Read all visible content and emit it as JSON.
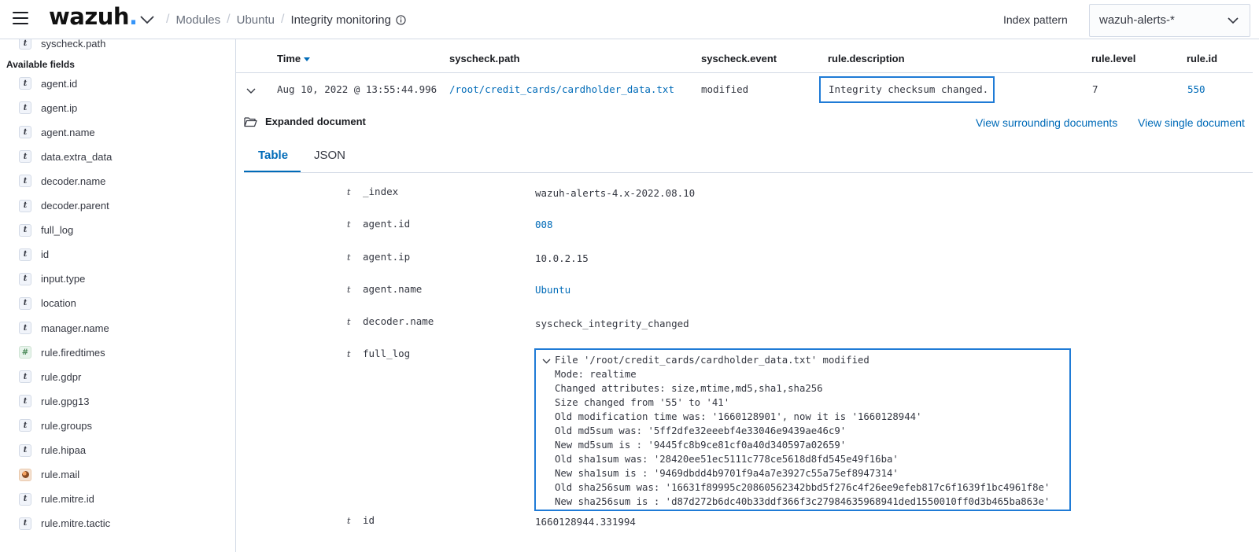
{
  "header": {
    "logo_text": "wazuh",
    "logo_dot": ".",
    "breadcrumbs": [
      "Modules",
      "Ubuntu"
    ],
    "current_page": "Integrity monitoring",
    "index_pattern_label": "Index pattern",
    "index_pattern_value": "wazuh-alerts-*"
  },
  "sidebar": {
    "selected_field": "syscheck.path",
    "available_fields_title": "Available fields",
    "fields": [
      {
        "name": "agent.id",
        "type": "t"
      },
      {
        "name": "agent.ip",
        "type": "t"
      },
      {
        "name": "agent.name",
        "type": "t"
      },
      {
        "name": "data.extra_data",
        "type": "t"
      },
      {
        "name": "decoder.name",
        "type": "t"
      },
      {
        "name": "decoder.parent",
        "type": "t"
      },
      {
        "name": "full_log",
        "type": "t"
      },
      {
        "name": "id",
        "type": "t"
      },
      {
        "name": "input.type",
        "type": "t"
      },
      {
        "name": "location",
        "type": "t"
      },
      {
        "name": "manager.name",
        "type": "t"
      },
      {
        "name": "rule.firedtimes",
        "type": "#"
      },
      {
        "name": "rule.gdpr",
        "type": "t"
      },
      {
        "name": "rule.gpg13",
        "type": "t"
      },
      {
        "name": "rule.groups",
        "type": "t"
      },
      {
        "name": "rule.hipaa",
        "type": "t"
      },
      {
        "name": "rule.mail",
        "type": "geo"
      },
      {
        "name": "rule.mitre.id",
        "type": "t"
      },
      {
        "name": "rule.mitre.tactic",
        "type": "t"
      }
    ]
  },
  "table": {
    "columns": [
      "Time",
      "syscheck.path",
      "syscheck.event",
      "rule.description",
      "rule.level",
      "rule.id"
    ],
    "row": {
      "time": "Aug 10, 2022 @ 13:55:44.996",
      "path": "/root/credit_cards/cardholder_data.txt",
      "event": "modified",
      "description": "Integrity checksum changed.",
      "level": "7",
      "id": "550"
    }
  },
  "document": {
    "title": "Expanded document",
    "view_surrounding": "View surrounding documents",
    "view_single": "View single document",
    "tabs": [
      "Table",
      "JSON"
    ],
    "type_marker": "t",
    "fields": [
      {
        "key": "_index",
        "value": "wazuh-alerts-4.x-2022.08.10"
      },
      {
        "key": "agent.id",
        "value": "008"
      },
      {
        "key": "agent.ip",
        "value": "10.0.2.15"
      },
      {
        "key": "agent.name",
        "value": "Ubuntu"
      },
      {
        "key": "decoder.name",
        "value": "syscheck_integrity_changed"
      },
      {
        "key": "full_log",
        "value": ""
      },
      {
        "key": "id",
        "value": "1660128944.331994"
      }
    ],
    "full_log_lines": [
      "File '/root/credit_cards/cardholder_data.txt' modified",
      "Mode: realtime",
      "Changed attributes: size,mtime,md5,sha1,sha256",
      "Size changed from '55' to '41'",
      "Old modification time was: '1660128901', now it is '1660128944'",
      "Old md5sum was: '5ff2dfe32eeebf4e33046e9439ae46c9'",
      "New md5sum is : '9445fc8b9ce81cf0a40d340597a02659'",
      "Old sha1sum was: '28420ee51ec5111c778ce5618d8fd545e49f16ba'",
      "New sha1sum is : '9469dbdd4b9701f9a4a7e3927c55a75ef8947314'",
      "Old sha256sum was: '16631f89995c20860562342bbd5f276c4f26ee9efeb817c6f1639f1bc4961f8e'",
      "New sha256sum is : 'd87d272b6dc40b33ddf366f3c27984635968941ded1550010ff0d3b465ba863e'"
    ]
  },
  "colors": {
    "accent": "#006bb8",
    "highlight": "#1f7bd6"
  }
}
